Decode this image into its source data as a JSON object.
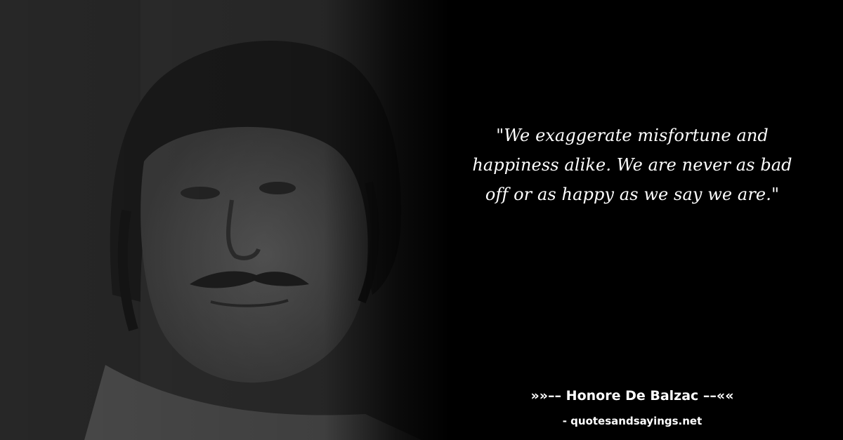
{
  "quote": {
    "text": "\"We exaggerate misfortune and happiness alike. We are never as bad off or as happy as we say we are.\""
  },
  "attribution": {
    "prefix": "»»–– ",
    "author": "Honore De Balzac",
    "suffix": " ––««"
  },
  "source": {
    "site": "- quotesandsayings.net"
  },
  "colors": {
    "background": "#000000",
    "text": "#ffffff"
  }
}
